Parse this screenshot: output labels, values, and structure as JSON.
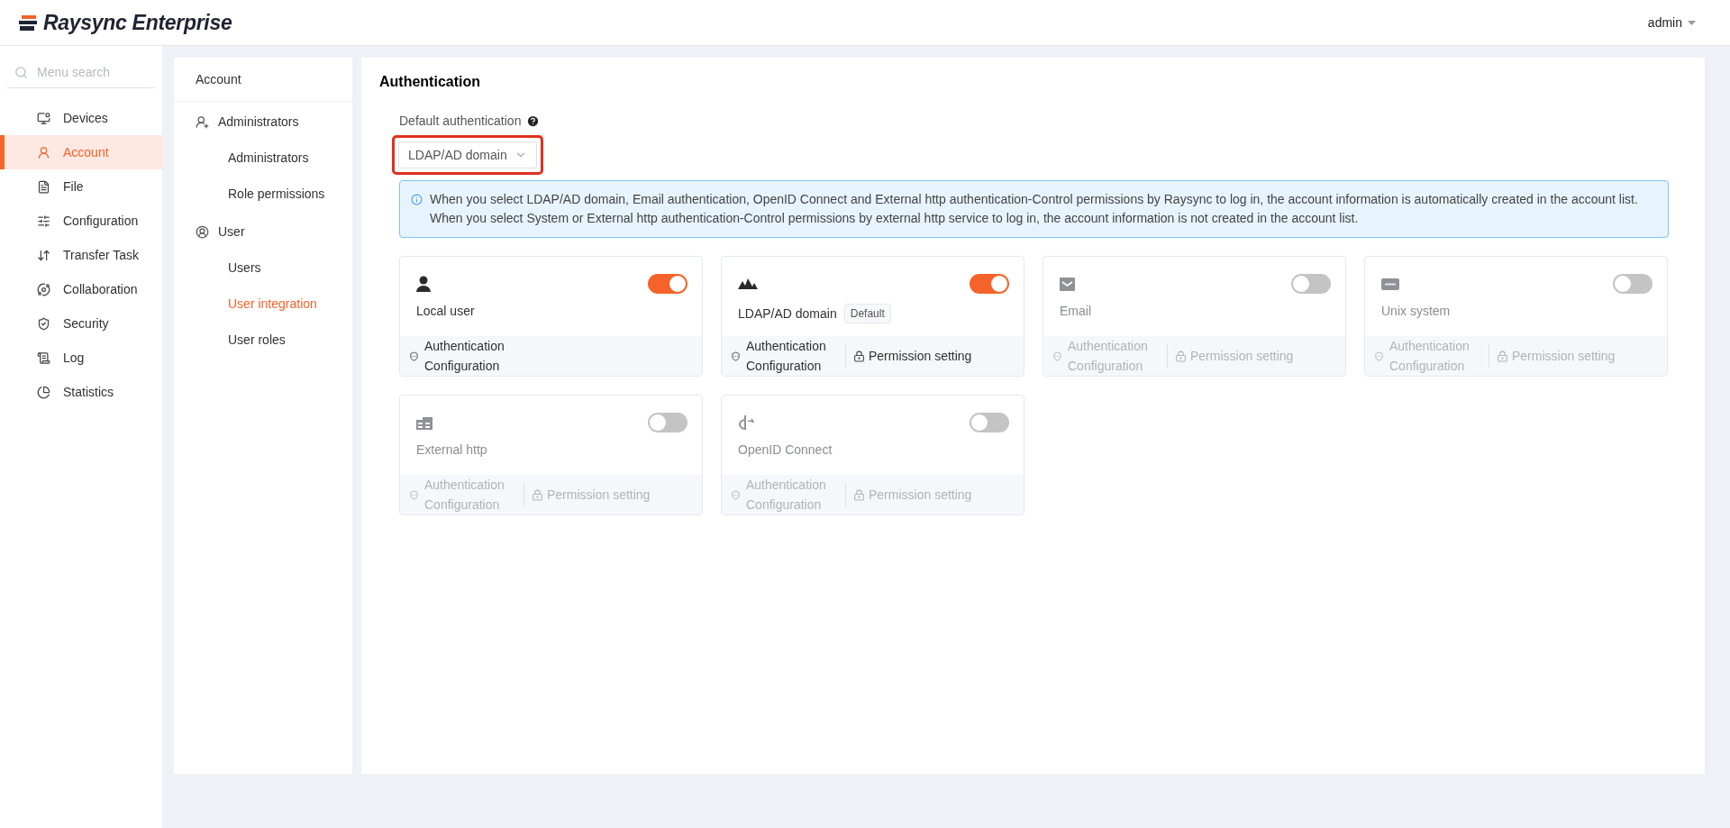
{
  "header": {
    "brand": "Raysync Enterprise",
    "user": "admin"
  },
  "sidebar": {
    "search": {
      "placeholder": "Menu search"
    },
    "items": [
      {
        "label": "Devices",
        "selected": false
      },
      {
        "label": "Account",
        "selected": true
      },
      {
        "label": "File",
        "selected": false
      },
      {
        "label": "Configuration",
        "selected": false
      },
      {
        "label": "Transfer Task",
        "selected": false
      },
      {
        "label": "Collaboration",
        "selected": false
      },
      {
        "label": "Security",
        "selected": false
      },
      {
        "label": "Log",
        "selected": false
      },
      {
        "label": "Statistics",
        "selected": false
      }
    ]
  },
  "submenu": {
    "title": "Account",
    "groups": [
      {
        "label": "Administrators",
        "children": [
          {
            "label": "Administrators",
            "selected": false
          },
          {
            "label": "Role permissions",
            "selected": false
          }
        ]
      },
      {
        "label": "User",
        "children": [
          {
            "label": "Users",
            "selected": false
          },
          {
            "label": "User integration",
            "selected": true
          },
          {
            "label": "User roles",
            "selected": false
          }
        ]
      }
    ]
  },
  "main": {
    "title": "Authentication",
    "default_auth": {
      "label": "Default authentication",
      "value": "LDAP/AD domain",
      "highlighted": true
    },
    "notice": [
      "When you select LDAP/AD domain, Email authentication, OpenID Connect and External http authentication-Control permissions by Raysync to log in, the account information is automatically created in the account list.",
      "When you select System or External http authentication-Control permissions by external http service to log in, the account information is not created in the account list."
    ],
    "cards": [
      {
        "kind": "local",
        "name": "Local user",
        "on": true,
        "auth_config": "Authentication Configuration"
      },
      {
        "kind": "ldap",
        "name": "LDAP/AD domain",
        "badge": "Default",
        "on": true,
        "auth_config": "Authentication Configuration",
        "permission": "Permission setting"
      },
      {
        "kind": "email",
        "name": "Email",
        "on": false,
        "auth_config": "Authentication Configuration",
        "permission": "Permission setting"
      },
      {
        "kind": "unix",
        "name": "Unix system",
        "on": false,
        "auth_config": "Authentication Configuration",
        "permission": "Permission setting"
      },
      {
        "kind": "http",
        "name": "External http",
        "on": false,
        "auth_config": "Authentication Configuration",
        "permission": "Permission setting"
      },
      {
        "kind": "openid",
        "name": "OpenID Connect",
        "on": false,
        "auth_config": "Authentication Configuration",
        "permission": "Permission setting"
      }
    ]
  }
}
